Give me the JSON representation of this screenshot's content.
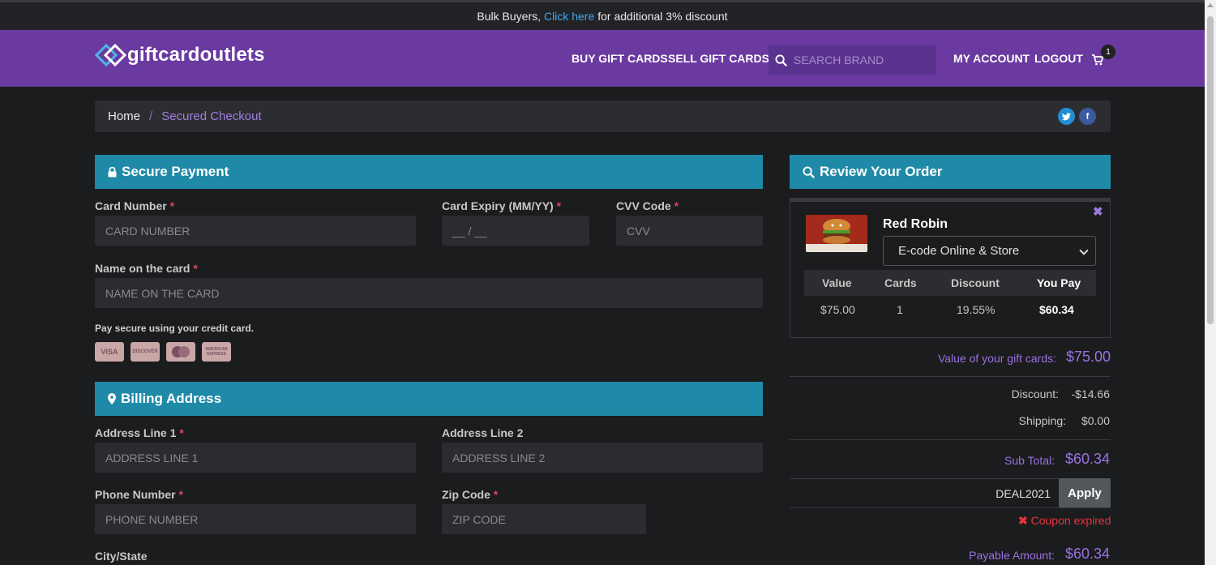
{
  "promo": {
    "prefix": "Bulk Buyers,",
    "link": "Click here",
    "suffix": "for additional 3% discount"
  },
  "header": {
    "logo": "giftcardoutlets",
    "nav": {
      "buy": "BUY GIFT CARDS",
      "sell": "SELL GIFT CARDS",
      "account": "MY ACCOUNT",
      "logout": "LOGOUT"
    },
    "search_placeholder": "SEARCH BRAND",
    "cart_count": "1"
  },
  "breadcrumb": {
    "home": "Home",
    "separator": "/",
    "current": "Secured Checkout"
  },
  "payment": {
    "title": "Secure Payment",
    "card_number_label": "Card Number",
    "card_number_placeholder": "CARD NUMBER",
    "expiry_label": "Card Expiry (MM/YY)",
    "expiry_placeholder": "__ / __",
    "cvv_label": "CVV Code",
    "cvv_placeholder": "CVV",
    "name_label": "Name on the card",
    "name_placeholder": "NAME ON THE CARD",
    "required_mark": "*",
    "pay_note": "Pay secure using your credit card.",
    "card_logos": [
      "VISA",
      "DISCOVER",
      "MC",
      "AMERICAN EXPRESS"
    ]
  },
  "billing": {
    "title": "Billing Address",
    "address1_label": "Address Line 1",
    "address1_placeholder": "ADDRESS LINE 1",
    "address2_label": "Address Line 2",
    "address2_placeholder": "ADDRESS LINE 2",
    "phone_label": "Phone Number",
    "phone_placeholder": "PHONE NUMBER",
    "zip_label": "Zip Code",
    "zip_placeholder": "ZIP CODE",
    "city_label": "City/State"
  },
  "review": {
    "title": "Review Your Order",
    "product_name": "Red Robin",
    "delivery_option": "E-code Online & Store",
    "columns": [
      "Value",
      "Cards",
      "Discount",
      "You Pay"
    ],
    "row": {
      "value": "$75.00",
      "cards": "1",
      "discount": "19.55%",
      "you_pay": "$60.34"
    },
    "value_label": "Value of your gift cards:",
    "value_amount": "$75.00",
    "discount_label": "Discount:",
    "discount_amount": "-$14.66",
    "shipping_label": "Shipping:",
    "shipping_amount": "$0.00",
    "subtotal_label": "Sub Total:",
    "subtotal_amount": "$60.34",
    "coupon_code": "DEAL2021",
    "apply_label": "Apply",
    "coupon_error": "Coupon expired",
    "payable_label": "Payable Amount:",
    "payable_amount": "$60.34"
  },
  "colors": {
    "header": "#6a3aa0",
    "section": "#1f8aa7",
    "accent": "#9a72e0",
    "error": "#e8323a"
  }
}
